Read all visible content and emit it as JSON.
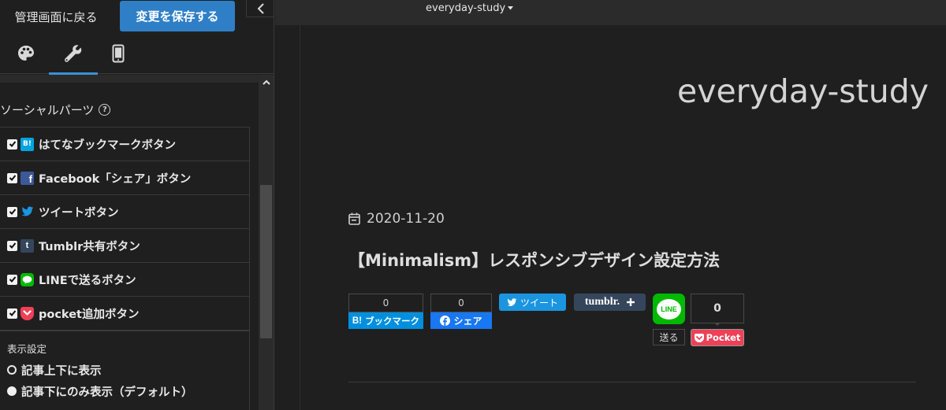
{
  "editor": {
    "back_label": "管理画面に戻る",
    "save_label": "変更を保存する",
    "tabs": [
      {
        "icon": "palette-icon"
      },
      {
        "icon": "wrench-icon",
        "active": true
      },
      {
        "icon": "smartphone-icon"
      }
    ],
    "section_title": "ソーシャルパーツ",
    "options": [
      {
        "label": "はてなブックマークボタン",
        "icon": "hatena-bookmark-icon",
        "checked": true
      },
      {
        "label": "Facebook「シェア」ボタン",
        "icon": "facebook-icon",
        "checked": true
      },
      {
        "label": "ツイートボタン",
        "icon": "twitter-icon",
        "checked": true
      },
      {
        "label": "Tumblr共有ボタン",
        "icon": "tumblr-icon",
        "checked": true
      },
      {
        "label": "LINEで送るボタン",
        "icon": "line-icon",
        "checked": true
      },
      {
        "label": "pocket追加ボタン",
        "icon": "pocket-icon",
        "checked": true
      }
    ],
    "display_title": "表示設定",
    "display_options": [
      {
        "label": "記事上下に表示",
        "selected": false
      },
      {
        "label": "記事下にのみ表示（デフォルト）",
        "selected": true
      }
    ]
  },
  "preview": {
    "site_menu": "everyday-study",
    "site_title": "everyday-study",
    "post_date": "2020-11-20",
    "post_title": "【Minimalism】レスポンシブデザイン設定方法",
    "share": {
      "hatena_count": "0",
      "hatena_label": "ブックマーク",
      "hatena_logo": "B!",
      "facebook_count": "0",
      "facebook_label": "シェア",
      "tweet_label": "ツイート",
      "tumblr_label": "tumblr.",
      "line_label": "送る",
      "line_logo": "LINE",
      "pocket_count": "0",
      "pocket_label": "Pocket"
    }
  },
  "colors": {
    "accent": "#2e7fc6",
    "hatena": "#00a4de",
    "facebook": "#1877f2",
    "twitter": "#1b95e0",
    "tumblr": "#35465c",
    "line": "#00b900",
    "pocket": "#ef4056"
  }
}
